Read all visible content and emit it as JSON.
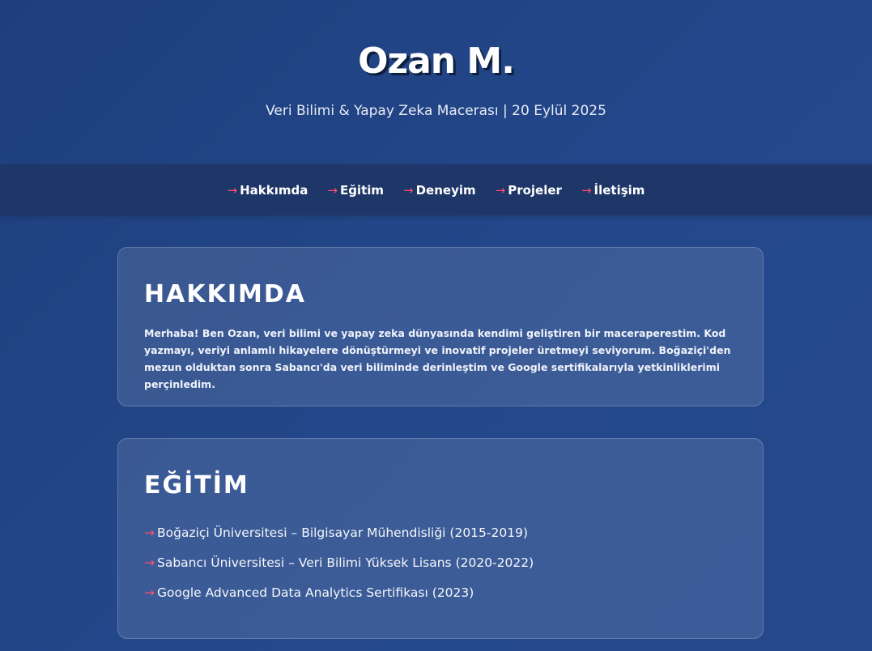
{
  "hero": {
    "name": "Ozan M.",
    "subtitle": "Veri Bilimi & Yapay Zeka Macerası | 20 Eylül 2025"
  },
  "nav": {
    "arrow": "→",
    "items": [
      {
        "label": "Hakkımda"
      },
      {
        "label": "Eğitim"
      },
      {
        "label": "Deneyim"
      },
      {
        "label": "Projeler"
      },
      {
        "label": "İletişim"
      }
    ]
  },
  "about": {
    "title": "HAKKIMDA",
    "text": "Merhaba! Ben Ozan, veri bilimi ve yapay zeka dünyasında kendimi geliştiren bir maceraperestim. Kod yazmayı, veriyi anlamlı hikayelere dönüştürmeyi ve inovatif projeler üretmeyi seviyorum. Boğaziçi'den mezun olduktan sonra Sabancı'da veri biliminde derinleştim ve Google sertifikalarıyla yetkinliklerimi perçinledim."
  },
  "education": {
    "title": "EĞİTİM",
    "arrow": "→",
    "items": [
      {
        "label": "Boğaziçi Üniversitesi – Bilgisayar Mühendisliği (2015-2019)"
      },
      {
        "label": "Sabancı Üniversitesi – Veri Bilimi Yüksek Lisans (2020-2022)"
      },
      {
        "label": "Google Advanced Data Analytics Sertifikası (2023)"
      }
    ]
  },
  "colors": {
    "background": "#23478a",
    "nav_background": "#1e3668",
    "accent_arrow": "#ff4f6d"
  }
}
